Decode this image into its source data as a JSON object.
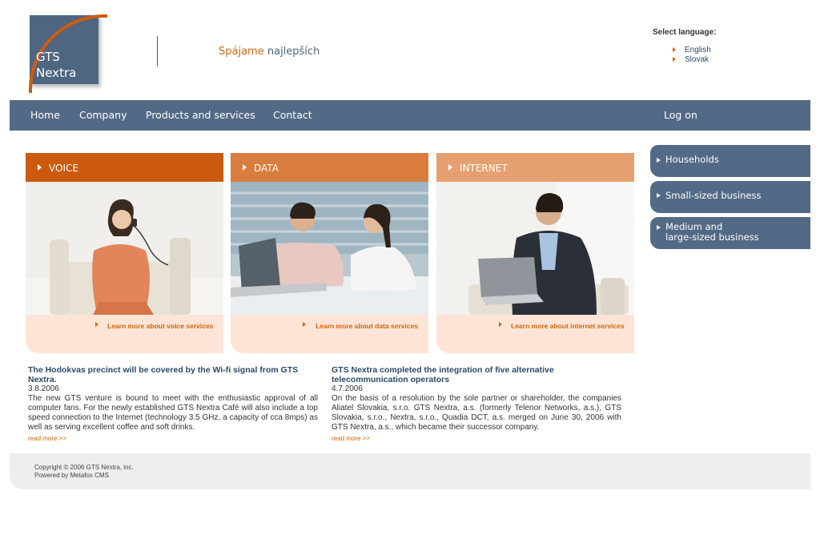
{
  "header": {
    "logo_line1": "GTS",
    "logo_line2": "Nextra",
    "slogan_part1": "Spájame",
    "slogan_part2": "najlepších"
  },
  "language": {
    "title": "Select language:",
    "options": [
      "English",
      "Slovak"
    ]
  },
  "nav": {
    "items": [
      "Home",
      "Company",
      "Products and services",
      "Contact"
    ],
    "login": "Log on"
  },
  "services": [
    {
      "label": "VOICE",
      "link": "Learn more about voice services",
      "color": "#cc5a0e"
    },
    {
      "label": "DATA",
      "link": "Learn more about data services",
      "color": "#d97d3e"
    },
    {
      "label": "INTERNET",
      "link": "Learn more about internet services",
      "color": "#e6a06f"
    }
  ],
  "side_buttons": [
    {
      "label": "Households"
    },
    {
      "label": "Small-sized business"
    },
    {
      "label_line1": "Medium and",
      "label_line2": "large-sized business"
    }
  ],
  "news": [
    {
      "title": "The Hodokvas precinct will be covered by the Wi-fi signal from GTS Nextra.",
      "date": "3.8.2006",
      "body": "The new GTS venture is bound to meet with the enthusiastic approval of all computer fans. For the newly established GTS Nextra Café will also include a top speed connection to the Internet (technology 3.5 GHz, a capacity of cca 8mps) as well as serving excellent coffee and soft drinks.",
      "more": "read more >>"
    },
    {
      "title": "GTS Nextra completed the integration of five alternative telecommunication operators",
      "date": "4.7.2006",
      "body": "On the basis of a resolution by the sole partner or shareholder, the companies Aliatel Slovakia, s.r.o. GTS Nextra, a.s. (formerly Telenor Networks, a.s.), GTS Slovakia, s.r.o., Nextra, s.r.o., Quadia DCT, a.s. merged on June 30, 2006 with GTS Nextra, a.s., which became their successor company.",
      "more": "read more >>"
    }
  ],
  "footer": {
    "copyright": "Copyright © 2006 GTS Nextra, inc.",
    "powered": "Powered by Metafox CMS"
  },
  "colors": {
    "brand_blue": "#526a85",
    "brand_orange": "#d2660f",
    "peach": "#fde4d6"
  }
}
